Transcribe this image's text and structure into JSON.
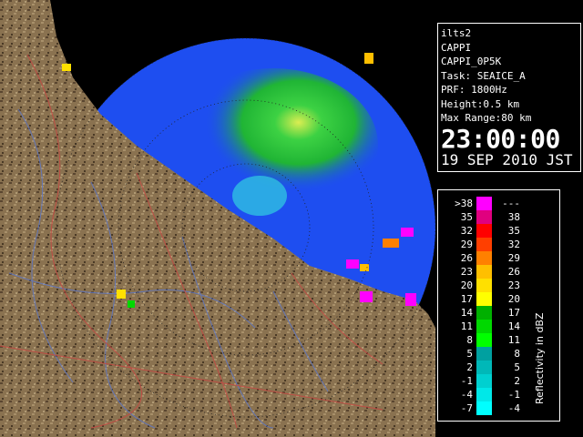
{
  "info": {
    "site": "ilts2",
    "product": "CAPPI",
    "product_code": "CAPPI_0P5K",
    "task": "Task: SEAICE_A",
    "prf": "PRF: 1800Hz",
    "height": "Height:0.5 km",
    "max_range": "Max Range:80 km",
    "time": "23:00:00",
    "date": "19 SEP 2010 JST"
  },
  "legend": {
    "title": "Reflectivity in dBZ",
    "rows": [
      {
        "lo": ">38",
        "hi": "---",
        "color": "#ff00ff"
      },
      {
        "lo": "35",
        "hi": "38",
        "color": "#e0007f"
      },
      {
        "lo": "32",
        "hi": "35",
        "color": "#ff0000"
      },
      {
        "lo": "29",
        "hi": "32",
        "color": "#ff3f00"
      },
      {
        "lo": "26",
        "hi": "29",
        "color": "#ff8000"
      },
      {
        "lo": "23",
        "hi": "26",
        "color": "#ffbf00"
      },
      {
        "lo": "20",
        "hi": "23",
        "color": "#ffe000"
      },
      {
        "lo": "17",
        "hi": "20",
        "color": "#ffff00"
      },
      {
        "lo": "14",
        "hi": "17",
        "color": "#00b000"
      },
      {
        "lo": "11",
        "hi": "14",
        "color": "#00d800"
      },
      {
        "lo": "8",
        "hi": "11",
        "color": "#00ff00"
      },
      {
        "lo": "5",
        "hi": "8",
        "color": "#00a0a0"
      },
      {
        "lo": "2",
        "hi": "5",
        "color": "#00b8b8"
      },
      {
        "lo": "-1",
        "hi": "2",
        "color": "#00d0d0"
      },
      {
        "lo": "-4",
        "hi": "-1",
        "color": "#00e8e8"
      },
      {
        "lo": "-7",
        "hi": "-4",
        "color": "#00ffff"
      }
    ]
  },
  "colors": {
    "land": "#8a7250",
    "sea_echo": "#1e4ef0",
    "ocean": "#000000"
  }
}
